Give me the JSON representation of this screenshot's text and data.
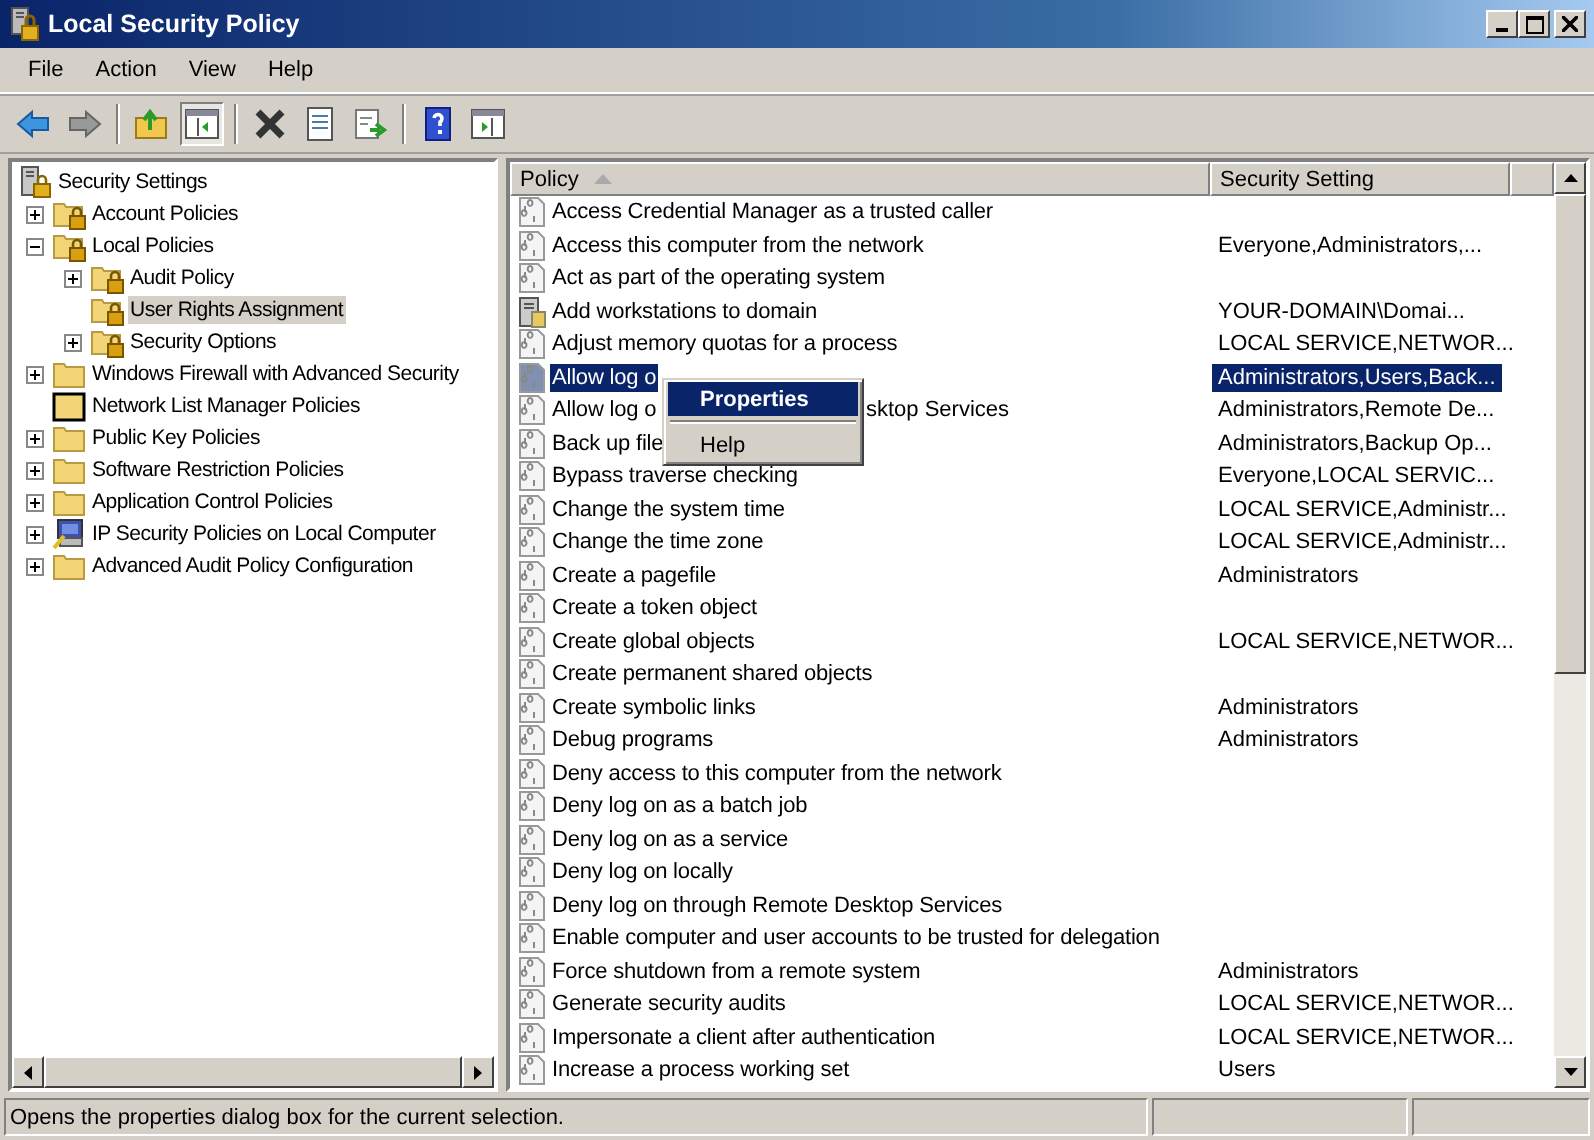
{
  "window": {
    "title": "Local Security Policy"
  },
  "menu": [
    "File",
    "Action",
    "View",
    "Help"
  ],
  "toolbar": [
    {
      "kind": "back",
      "pressed": false
    },
    {
      "kind": "forward",
      "pressed": false
    },
    {
      "kind": "sep"
    },
    {
      "kind": "up",
      "pressed": false
    },
    {
      "kind": "tree",
      "pressed": true
    },
    {
      "kind": "sep"
    },
    {
      "kind": "delete",
      "pressed": false
    },
    {
      "kind": "properties",
      "pressed": false
    },
    {
      "kind": "export",
      "pressed": false
    },
    {
      "kind": "sep"
    },
    {
      "kind": "help",
      "pressed": false
    },
    {
      "kind": "actionpane",
      "pressed": false
    }
  ],
  "tree": [
    {
      "label": "Security Settings",
      "kind": "server",
      "selected": false,
      "children": [
        {
          "label": "Account Policies",
          "kind": "lockfolder",
          "expanded": false,
          "selected": false
        },
        {
          "label": "Local Policies",
          "kind": "lockfolder",
          "expanded": true,
          "selected": false,
          "children": [
            {
              "label": "Audit Policy",
              "kind": "lockfolder",
              "expanded": false,
              "selected": false
            },
            {
              "label": "User Rights Assignment",
              "kind": "lockfolder",
              "selected": true
            },
            {
              "label": "Security Options",
              "kind": "lockfolder",
              "expanded": false,
              "selected": false
            }
          ]
        },
        {
          "label": "Windows Firewall with Advanced Security",
          "kind": "folder",
          "expanded": false,
          "selected": false
        },
        {
          "label": "Network List Manager Policies",
          "kind": "darkfolder",
          "selected": false
        },
        {
          "label": "Public Key Policies",
          "kind": "folder",
          "expanded": false,
          "selected": false
        },
        {
          "label": "Software Restriction Policies",
          "kind": "folder",
          "expanded": false,
          "selected": false
        },
        {
          "label": "Application Control Policies",
          "kind": "folder",
          "expanded": false,
          "selected": false
        },
        {
          "label": "IP Security Policies on Local Computer",
          "kind": "computer",
          "expanded": false,
          "selected": false
        },
        {
          "label": "Advanced Audit Policy Configuration",
          "kind": "folder",
          "expanded": false,
          "selected": false
        }
      ]
    }
  ],
  "table": {
    "columns": [
      "Policy",
      "Security Setting"
    ],
    "rows": [
      {
        "kind": "policy",
        "policy": "Access Credential Manager as a trusted caller",
        "selected": false
      },
      {
        "kind": "policy",
        "policy": "Access this computer from the network",
        "setting": "Everyone,Administrators,...",
        "selected": false
      },
      {
        "kind": "policy",
        "policy": "Act as part of the operating system",
        "selected": false
      },
      {
        "kind": "domain",
        "policy": "Add workstations to domain",
        "setting": "YOUR-DOMAIN\\Domai...",
        "selected": false
      },
      {
        "kind": "policy",
        "policy": "Adjust memory quotas for a process",
        "setting": "LOCAL SERVICE,NETWOR...",
        "selected": false
      },
      {
        "kind": "policy",
        "policy": "Allow log o",
        "setting": "Administrators,Users,Back...",
        "selected": true
      },
      {
        "kind": "policy",
        "policy": "Allow log o",
        "policy_tail": "sktop Services",
        "setting": "Administrators,Remote De...",
        "selected": false
      },
      {
        "kind": "policy",
        "policy": "Back up file",
        "setting": "Administrators,Backup Op...",
        "selected": false
      },
      {
        "kind": "policy",
        "policy": "Bypass traverse checking",
        "setting": "Everyone,LOCAL SERVIC...",
        "selected": false
      },
      {
        "kind": "policy",
        "policy": "Change the system time",
        "setting": "LOCAL SERVICE,Administr...",
        "selected": false
      },
      {
        "kind": "policy",
        "policy": "Change the time zone",
        "setting": "LOCAL SERVICE,Administr...",
        "selected": false
      },
      {
        "kind": "policy",
        "policy": "Create a pagefile",
        "setting": "Administrators",
        "selected": false
      },
      {
        "kind": "policy",
        "policy": "Create a token object",
        "selected": false
      },
      {
        "kind": "policy",
        "policy": "Create global objects",
        "setting": "LOCAL SERVICE,NETWOR...",
        "selected": false
      },
      {
        "kind": "policy",
        "policy": "Create permanent shared objects",
        "selected": false
      },
      {
        "kind": "policy",
        "policy": "Create symbolic links",
        "setting": "Administrators",
        "selected": false
      },
      {
        "kind": "policy",
        "policy": "Debug programs",
        "setting": "Administrators",
        "selected": false
      },
      {
        "kind": "policy",
        "policy": "Deny access to this computer from the network",
        "selected": false
      },
      {
        "kind": "policy",
        "policy": "Deny log on as a batch job",
        "selected": false
      },
      {
        "kind": "policy",
        "policy": "Deny log on as a service",
        "selected": false
      },
      {
        "kind": "policy",
        "policy": "Deny log on locally",
        "selected": false
      },
      {
        "kind": "policy",
        "policy": "Deny log on through Remote Desktop Services",
        "selected": false
      },
      {
        "kind": "policy",
        "policy": "Enable computer and user accounts to be trusted for delegation",
        "selected": false
      },
      {
        "kind": "policy",
        "policy": "Force shutdown from a remote system",
        "setting": "Administrators",
        "selected": false
      },
      {
        "kind": "policy",
        "policy": "Generate security audits",
        "setting": "LOCAL SERVICE,NETWOR...",
        "selected": false
      },
      {
        "kind": "policy",
        "policy": "Impersonate a client after authentication",
        "setting": "LOCAL SERVICE,NETWOR...",
        "selected": false
      },
      {
        "kind": "policy",
        "policy": "Increase a process working set",
        "setting": "Users",
        "selected": false
      }
    ]
  },
  "context_menu": [
    {
      "kind": "item",
      "label": "Properties",
      "selected": true
    },
    {
      "kind": "separator"
    },
    {
      "kind": "item",
      "label": "Help",
      "selected": false
    }
  ],
  "status_bar": {
    "text": "Opens the properties dialog box for the current selection."
  }
}
